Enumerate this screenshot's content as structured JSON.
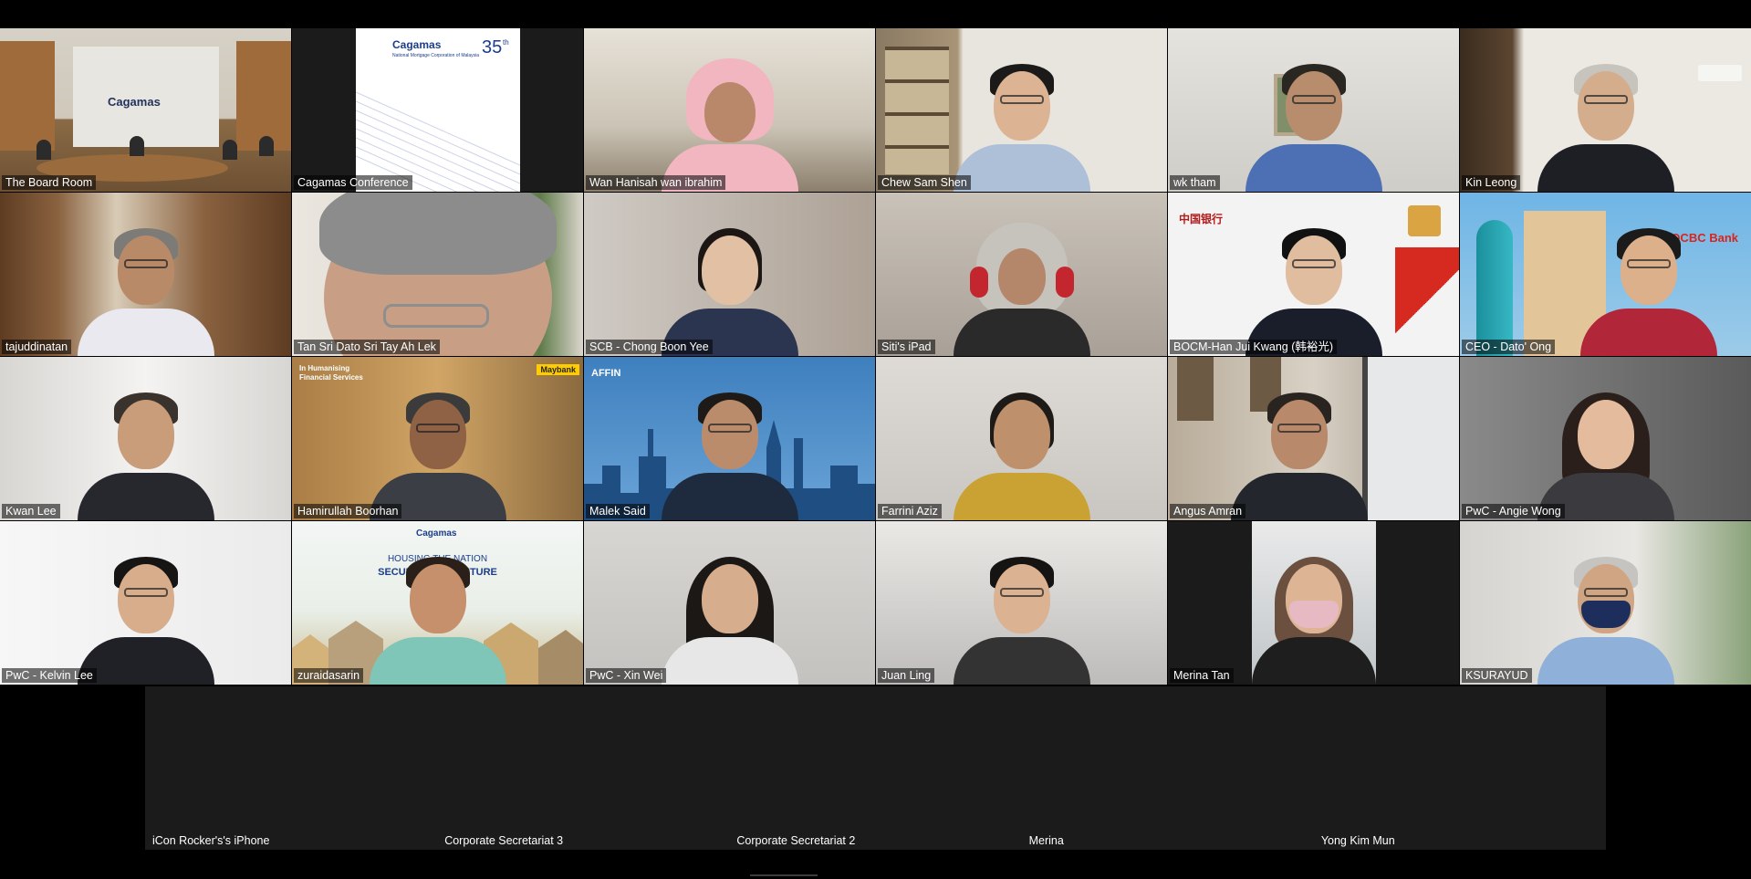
{
  "meeting": {
    "tiles": [
      {
        "name": "The Board Room"
      },
      {
        "name": "Cagamas Conference"
      },
      {
        "name": "Wan Hanisah wan ibrahim"
      },
      {
        "name": "Chew Sam Shen"
      },
      {
        "name": "wk tham"
      },
      {
        "name": "Kin Leong"
      },
      {
        "name": "tajuddinatan"
      },
      {
        "name": "Tan Sri Dato Sri Tay Ah Lek"
      },
      {
        "name": "SCB - Chong Boon Yee"
      },
      {
        "name": "Siti's iPad"
      },
      {
        "name": "BOCM-Han Jui Kwang (韩裕光)"
      },
      {
        "name": "CEO - Dato' Ong"
      },
      {
        "name": "Kwan Lee"
      },
      {
        "name": "Hamirullah Boorhan"
      },
      {
        "name": "Malek Said"
      },
      {
        "name": "Farrini Aziz"
      },
      {
        "name": "Angus Amran"
      },
      {
        "name": "PwC - Angie Wong"
      },
      {
        "name": "PwC - Kelvin Lee"
      },
      {
        "name": "zuraidasarin"
      },
      {
        "name": "PwC - Xin Wei"
      },
      {
        "name": "Juan Ling"
      },
      {
        "name": "Merina Tan"
      },
      {
        "name": "KSURAYUD"
      }
    ],
    "audio_only": [
      {
        "name": "iCon Rocker's's iPhone"
      },
      {
        "name": "Corporate Secretariat 3"
      },
      {
        "name": "Corporate Secretariat 2"
      },
      {
        "name": "Merina"
      },
      {
        "name": "Yong Kim Mun"
      }
    ],
    "backgrounds": {
      "board_room_logo": "Cagamas",
      "conference_logo": "Cagamas",
      "conference_tagline": "National Mortgage Corporation of Malaysia",
      "conference_anniversary": "35",
      "conference_anniversary_suffix": "th",
      "bocm_bank": "中国银行",
      "ocbc_logo": "OCBC Bank",
      "maybank_logo": "Maybank",
      "maybank_slogan": "In Humanising Financial Services",
      "affin_logo": "AFFIN",
      "housing_logo": "Cagamas",
      "housing_line1": "HOUSING THE NATION",
      "housing_line2": "SECURING THE FUTURE"
    }
  },
  "colors": {
    "app_background": "#000000",
    "audio_strip": "#1b1b1b",
    "label_text": "#ffffff",
    "cagamas_blue": "#1b3d8a",
    "affin_blue": "#2d6fb0",
    "ocbc_red": "#d9251c",
    "bocm_red": "#b31b1b"
  }
}
